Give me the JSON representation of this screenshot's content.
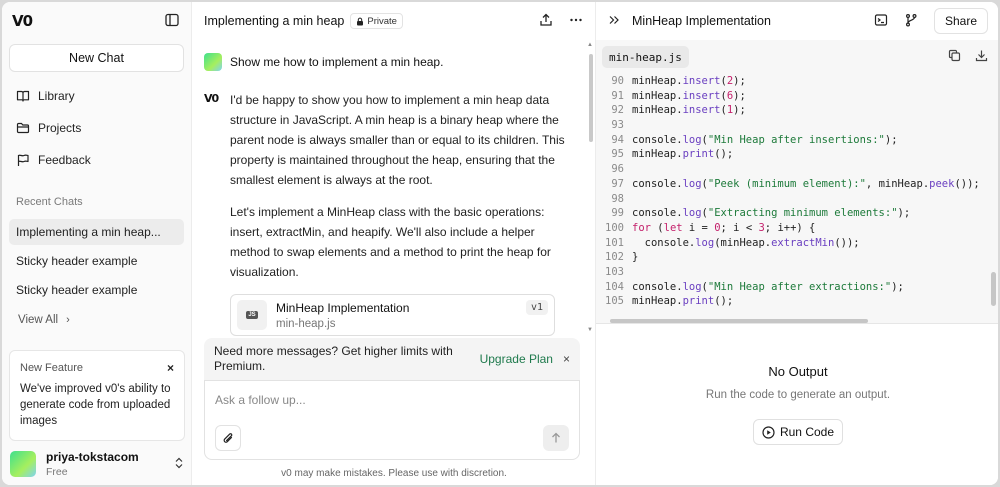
{
  "sidebar": {
    "logo": "V0",
    "new_chat": "New Chat",
    "nav": [
      {
        "label": "Library",
        "icon": "book-icon"
      },
      {
        "label": "Projects",
        "icon": "folder-icon"
      },
      {
        "label": "Feedback",
        "icon": "flag-icon"
      }
    ],
    "recent_label": "Recent Chats",
    "recent": [
      {
        "label": "Implementing a min heap..."
      },
      {
        "label": "Sticky header example"
      },
      {
        "label": "Sticky header example"
      }
    ],
    "view_all": "View All",
    "feature": {
      "label": "New Feature",
      "close": "×",
      "body": "We've improved v0's ability to generate code from uploaded images"
    },
    "user": {
      "name": "priya-tokstacom",
      "plan": "Free"
    }
  },
  "chat": {
    "title": "Implementing a min heap",
    "private_label": "Private",
    "user_message": "Show me how to implement a min heap.",
    "ai_paragraphs": [
      "I'd be happy to show you how to implement a min heap data structure in JavaScript. A min heap is a binary heap where the parent node is always smaller than or equal to its children. This property is maintained throughout the heap, ensuring that the smallest element is always at the root.",
      "Let's implement a MinHeap class with the basic operations: insert, extractMin, and heapify. We'll also include a helper method to swap elements and a method to print the heap for visualization."
    ],
    "artifact": {
      "title": "MinHeap Implementation",
      "file": "min-heap.js",
      "version": "v1",
      "badge": "JS"
    },
    "upgrade": {
      "text": "Need more messages? Get higher limits with Premium.",
      "link": "Upgrade Plan",
      "close": "×"
    },
    "composer_placeholder": "Ask a follow up...",
    "disclaimer": "v0 may make mistakes. Please use with discretion."
  },
  "panel": {
    "title": "MinHeap Implementation",
    "share": "Share",
    "file_tab": "min-heap.js",
    "code_lines": [
      {
        "n": 90,
        "t": [
          [
            "txt",
            "minHeap."
          ],
          [
            "fn",
            "insert"
          ],
          [
            "txt",
            "("
          ],
          [
            "num",
            "2"
          ],
          [
            "txt",
            ");"
          ]
        ]
      },
      {
        "n": 91,
        "t": [
          [
            "txt",
            "minHeap."
          ],
          [
            "fn",
            "insert"
          ],
          [
            "txt",
            "("
          ],
          [
            "num",
            "6"
          ],
          [
            "txt",
            ");"
          ]
        ]
      },
      {
        "n": 92,
        "t": [
          [
            "txt",
            "minHeap."
          ],
          [
            "fn",
            "insert"
          ],
          [
            "txt",
            "("
          ],
          [
            "num",
            "1"
          ],
          [
            "txt",
            ");"
          ]
        ]
      },
      {
        "n": 93,
        "t": []
      },
      {
        "n": 94,
        "t": [
          [
            "txt",
            "console."
          ],
          [
            "fn",
            "log"
          ],
          [
            "txt",
            "("
          ],
          [
            "str",
            "\"Min Heap after insertions:\""
          ],
          [
            "txt",
            ");"
          ]
        ]
      },
      {
        "n": 95,
        "t": [
          [
            "txt",
            "minHeap."
          ],
          [
            "fn",
            "print"
          ],
          [
            "txt",
            "();"
          ]
        ]
      },
      {
        "n": 96,
        "t": []
      },
      {
        "n": 97,
        "t": [
          [
            "txt",
            "console."
          ],
          [
            "fn",
            "log"
          ],
          [
            "txt",
            "("
          ],
          [
            "str",
            "\"Peek (minimum element):\""
          ],
          [
            "txt",
            ", minHeap."
          ],
          [
            "fn",
            "peek"
          ],
          [
            "txt",
            "());"
          ]
        ]
      },
      {
        "n": 98,
        "t": []
      },
      {
        "n": 99,
        "t": [
          [
            "txt",
            "console."
          ],
          [
            "fn",
            "log"
          ],
          [
            "txt",
            "("
          ],
          [
            "str",
            "\"Extracting minimum elements:\""
          ],
          [
            "txt",
            ");"
          ]
        ]
      },
      {
        "n": 100,
        "t": [
          [
            "kw",
            "for"
          ],
          [
            "txt",
            " ("
          ],
          [
            "kw",
            "let"
          ],
          [
            "txt",
            " i = "
          ],
          [
            "num",
            "0"
          ],
          [
            "txt",
            "; i < "
          ],
          [
            "num",
            "3"
          ],
          [
            "txt",
            "; i++) {"
          ]
        ]
      },
      {
        "n": 101,
        "t": [
          [
            "txt",
            "  console."
          ],
          [
            "fn",
            "log"
          ],
          [
            "txt",
            "(minHeap."
          ],
          [
            "fn",
            "extractMin"
          ],
          [
            "txt",
            "());"
          ]
        ]
      },
      {
        "n": 102,
        "t": [
          [
            "txt",
            "}"
          ]
        ]
      },
      {
        "n": 103,
        "t": []
      },
      {
        "n": 104,
        "t": [
          [
            "txt",
            "console."
          ],
          [
            "fn",
            "log"
          ],
          [
            "txt",
            "("
          ],
          [
            "str",
            "\"Min Heap after extractions:\""
          ],
          [
            "txt",
            ");"
          ]
        ]
      },
      {
        "n": 105,
        "t": [
          [
            "txt",
            "minHeap."
          ],
          [
            "fn",
            "print"
          ],
          [
            "txt",
            "();"
          ]
        ]
      }
    ],
    "output_title": "No Output",
    "output_sub": "Run the code to generate an output.",
    "run": "Run Code"
  }
}
